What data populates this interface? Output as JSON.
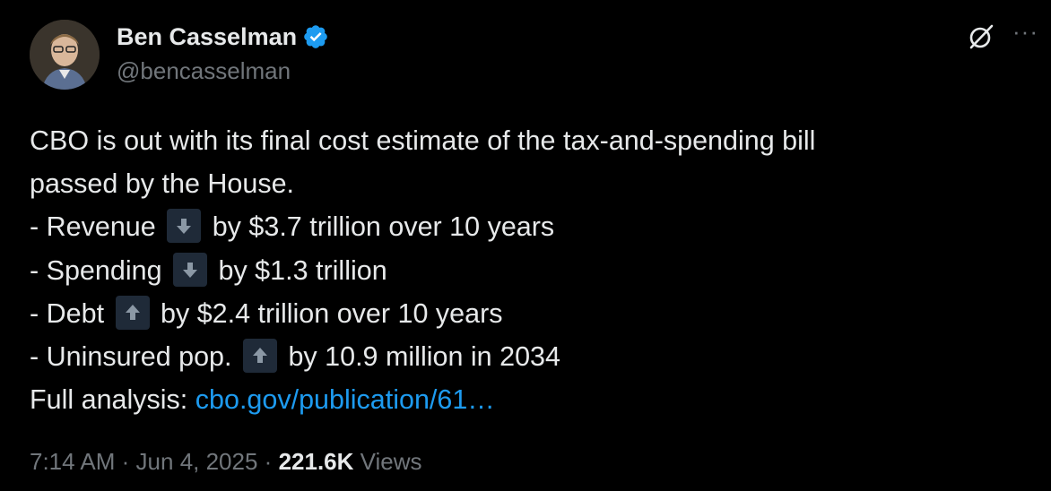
{
  "author": {
    "display_name": "Ben Casselman",
    "handle": "@bencasselman",
    "verified_color": "#1d9bf0"
  },
  "icons": {
    "top_right": [
      "grok-icon",
      "more-icon"
    ],
    "more_glyph": "···"
  },
  "tweet": {
    "intro_line1": "CBO is out with its final cost estimate of the tax-and-spending bill",
    "intro_line2": "passed by the House.",
    "items": [
      {
        "prefix": "- Revenue",
        "direction": "down",
        "suffix": "by $3.7 trillion over 10 years"
      },
      {
        "prefix": "- Spending",
        "direction": "down",
        "suffix": "by $1.3 trillion"
      },
      {
        "prefix": "- Debt",
        "direction": "up",
        "suffix": "by $2.4 trillion over 10 years"
      },
      {
        "prefix": "- Uninsured pop.",
        "direction": "up",
        "suffix": "by 10.9 million in 2034"
      }
    ],
    "analysis_label": "Full analysis:",
    "analysis_link": "cbo.gov/publication/61…",
    "link_color": "#1d9bf0"
  },
  "meta": {
    "time": "7:14 AM",
    "separator": "·",
    "date": "Jun 4, 2025",
    "views_count": "221.6K",
    "views_label": "Views"
  }
}
